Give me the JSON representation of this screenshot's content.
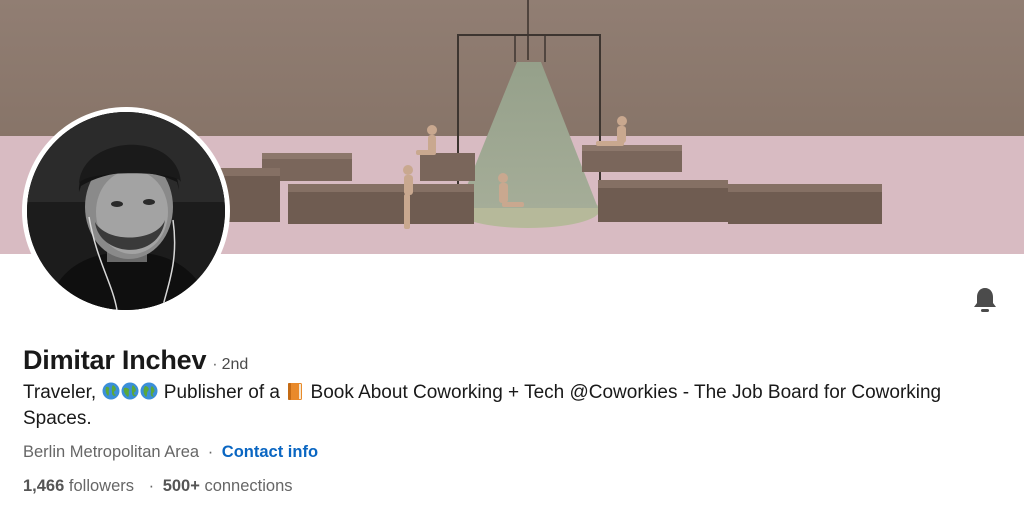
{
  "profile": {
    "name": "Dimitar Inchev",
    "degree_separator": "·",
    "degree": "2nd",
    "headline": {
      "part1": "Traveler,",
      "part2": "Publisher of a",
      "part3": "Book About Coworking + Tech @Coworkies - The Job Board for Coworking Spaces."
    },
    "location": "Berlin Metropolitan Area",
    "location_separator": "·",
    "contact_info_label": "Contact info",
    "followers_count": "1,466",
    "followers_label": "followers",
    "stats_separator": "·",
    "connections_count": "500+",
    "connections_label": "connections"
  },
  "icons": {
    "notify": "bell-icon",
    "headline_emoji": [
      "globe-icon",
      "globe-icon",
      "globe-icon",
      "book-icon"
    ]
  },
  "colors": {
    "link": "#0a66c2",
    "banner_wall": "#8d7b70",
    "banner_floor": "#d9bcc3",
    "text_secondary": "#666666"
  }
}
